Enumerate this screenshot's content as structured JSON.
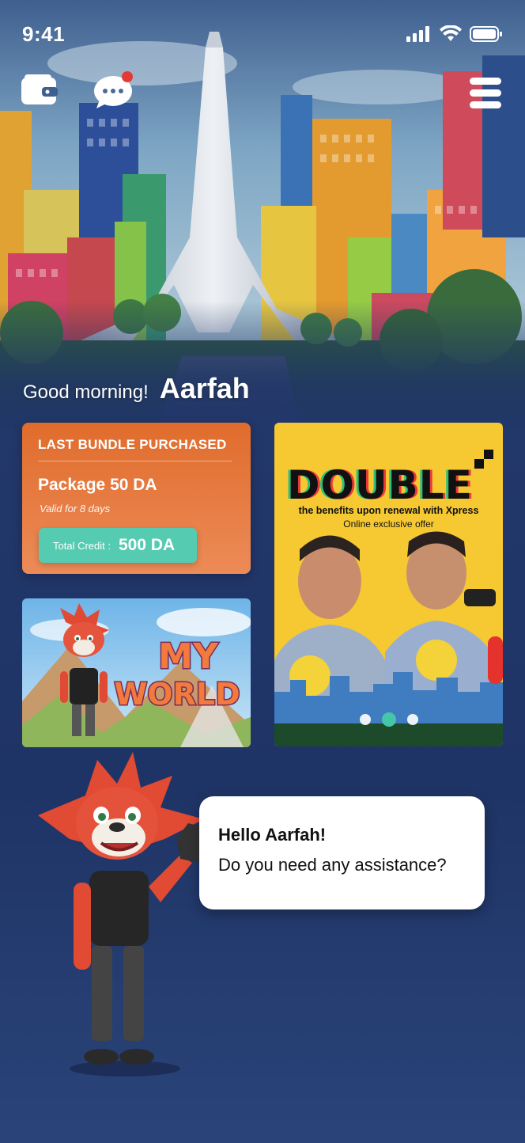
{
  "status_bar": {
    "time": "9:41"
  },
  "header": {
    "wallet_icon": "wallet-icon",
    "chat_icon": "chat-bubble-icon",
    "menu_icon": "hamburger-menu-icon",
    "has_notification": true
  },
  "greeting": {
    "text": "Good morning!",
    "name": "Aarfah"
  },
  "bundle_card": {
    "heading": "LAST BUNDLE PURCHASED",
    "package": "Package 50 DA",
    "validity": "Valid for 8 days",
    "credit_label": "Total Credit :",
    "credit_value": "500 DA"
  },
  "game_card": {
    "title_line1": "MY",
    "title_line2": "WORLD"
  },
  "promo_card": {
    "title": "DOUBLE",
    "subtitle": "the benefits upon renewal with Xpress",
    "note": "Online exclusive offer",
    "carousel_count": 3,
    "carousel_active": 2
  },
  "assistant": {
    "greeting": "Hello Aarfah!",
    "question": "Do you need any assistance?"
  },
  "colors": {
    "background": "#24386a",
    "bundle_orange": "#e06c2c",
    "credit_teal": "#55cbb1",
    "promo_yellow": "#f6c932",
    "notification_red": "#e53935"
  }
}
